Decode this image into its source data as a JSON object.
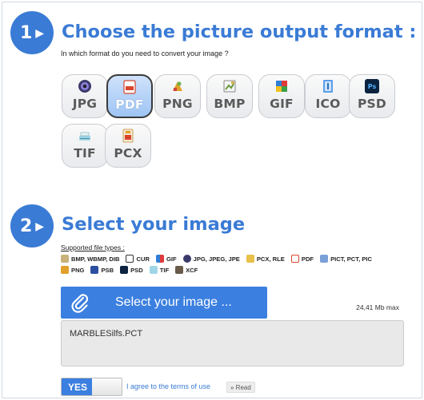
{
  "step1": {
    "number": "1",
    "title": "Choose the picture output format :",
    "subtitle": "In which format do you need to convert your image ?"
  },
  "formats": [
    {
      "label": "JPG",
      "icon": "jpg-camera-icon",
      "selected": false
    },
    {
      "label": "PDF",
      "icon": "pdf-file-icon",
      "selected": true
    },
    {
      "label": "PNG",
      "icon": "png-image-icon",
      "selected": false
    },
    {
      "label": "BMP",
      "icon": "bmp-image-icon",
      "selected": false
    },
    {
      "label": "GIF",
      "icon": "gif-image-icon",
      "selected": false
    },
    {
      "label": "ICO",
      "icon": "ico-icon",
      "selected": false
    },
    {
      "label": "PSD",
      "icon": "psd-photoshop-icon",
      "selected": false
    },
    {
      "label": "TIF",
      "icon": "tif-scanner-icon",
      "selected": false
    },
    {
      "label": "PCX",
      "icon": "pcx-image-icon",
      "selected": false
    }
  ],
  "step2": {
    "number": "2",
    "title": "Select your image",
    "supported_title": "Supported file types :",
    "types_row1": [
      "BMP, WBMP, DIB",
      "CUR",
      "GIF",
      "JPG, JPEG, JPE",
      "PCX, RLE",
      "PDF",
      "PICT, PCT, PIC"
    ],
    "types_row2": [
      "PNG",
      "PSB",
      "PSD",
      "TIF",
      "XCF"
    ]
  },
  "upload": {
    "button_label": "Select your image ...",
    "max_size": "24,41 Mb max",
    "file_name": "MARBLESilfs.PCT"
  },
  "terms": {
    "toggle_label": "YES",
    "text": "I agree to the terms of use",
    "read_label": "» Read"
  },
  "colors": {
    "accent": "#3a7bd5",
    "button": "#3b7fe0"
  }
}
